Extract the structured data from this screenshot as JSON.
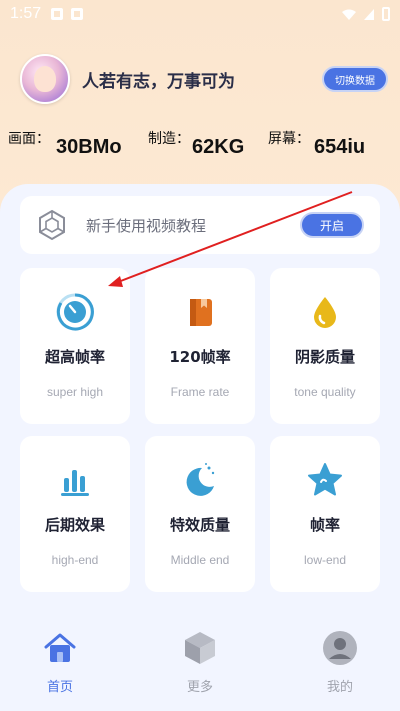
{
  "status_bar": {
    "time": "1:57"
  },
  "header": {
    "motto": "人若有志，万事可为",
    "switch_label": "切换数据"
  },
  "stats": [
    {
      "label": "画面：",
      "value": "30BMo"
    },
    {
      "label": "制造：",
      "value": "62KG"
    },
    {
      "label": "屏幕：",
      "value": "654iu"
    }
  ],
  "tutorial": {
    "text": "新手使用视频教程",
    "button": "开启"
  },
  "cards": [
    {
      "title": "超高帧率",
      "subtitle": "super high",
      "icon": "speed-gauge-icon"
    },
    {
      "title": "120帧率",
      "subtitle": "Frame rate",
      "icon": "book-icon"
    },
    {
      "title": "阴影质量",
      "subtitle": "tone quality",
      "icon": "droplet-icon"
    },
    {
      "title": "后期效果",
      "subtitle": "high-end",
      "icon": "bar-chart-icon"
    },
    {
      "title": "特效质量",
      "subtitle": "Middle end",
      "icon": "moon-icon"
    },
    {
      "title": "帧率",
      "subtitle": "low-end",
      "icon": "star-icon"
    }
  ],
  "nav": [
    {
      "label": "首页",
      "icon": "home-icon",
      "active": true
    },
    {
      "label": "更多",
      "icon": "cube-icon",
      "active": false
    },
    {
      "label": "我的",
      "icon": "user-icon",
      "active": false
    }
  ],
  "colors": {
    "accent": "#4a73e3",
    "annotation_arrow": "#e02020"
  }
}
